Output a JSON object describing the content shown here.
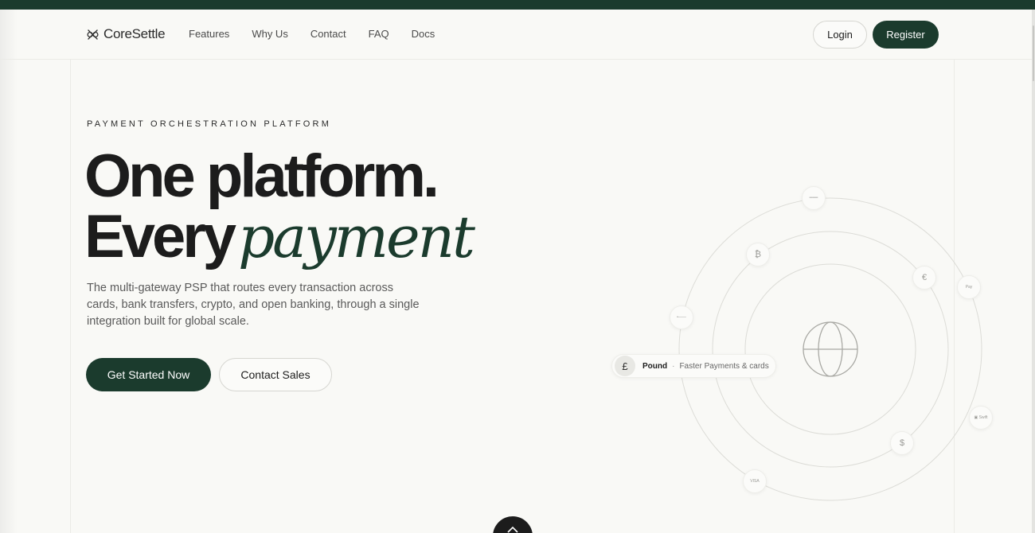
{
  "brand": {
    "name": "CoreSettle"
  },
  "nav": {
    "items": [
      "Features",
      "Why Us",
      "Contact",
      "FAQ",
      "Docs"
    ]
  },
  "auth": {
    "login_label": "Login",
    "register_label": "Register"
  },
  "hero": {
    "eyebrow": "PAYMENT ORCHESTRATION PLATFORM",
    "headline_line1": "One platform.",
    "headline_line2_plain": "Every",
    "headline_line2_accent": "payment",
    "lede": "The multi-gateway PSP that routes every transaction across cards, bank transfers, crypto, and open banking, through a single integration built for global scale.",
    "primary_cta": "Get Started Now",
    "secondary_cta": "Contact Sales"
  },
  "orbit": {
    "active": {
      "symbol": "£",
      "name": "Pound",
      "separator": "·",
      "description": "Faster Payments & cards"
    },
    "nodes": [
      {
        "name": "bank-icon",
        "label": "═══"
      },
      {
        "name": "bitcoin-icon",
        "label": "₿"
      },
      {
        "name": "euro-icon",
        "label": "€"
      },
      {
        "name": "apple-pay-icon",
        "label": "Pay"
      },
      {
        "name": "sepa-icon",
        "label": "•——"
      },
      {
        "name": "swift-icon",
        "label": "▣ Swift"
      },
      {
        "name": "dollar-icon",
        "label": "$"
      },
      {
        "name": "visa-icon",
        "label": "VISA"
      }
    ]
  },
  "colors": {
    "brand": "#1b3b2d",
    "background": "#f9f9f6",
    "text": "#1c1c1c"
  }
}
